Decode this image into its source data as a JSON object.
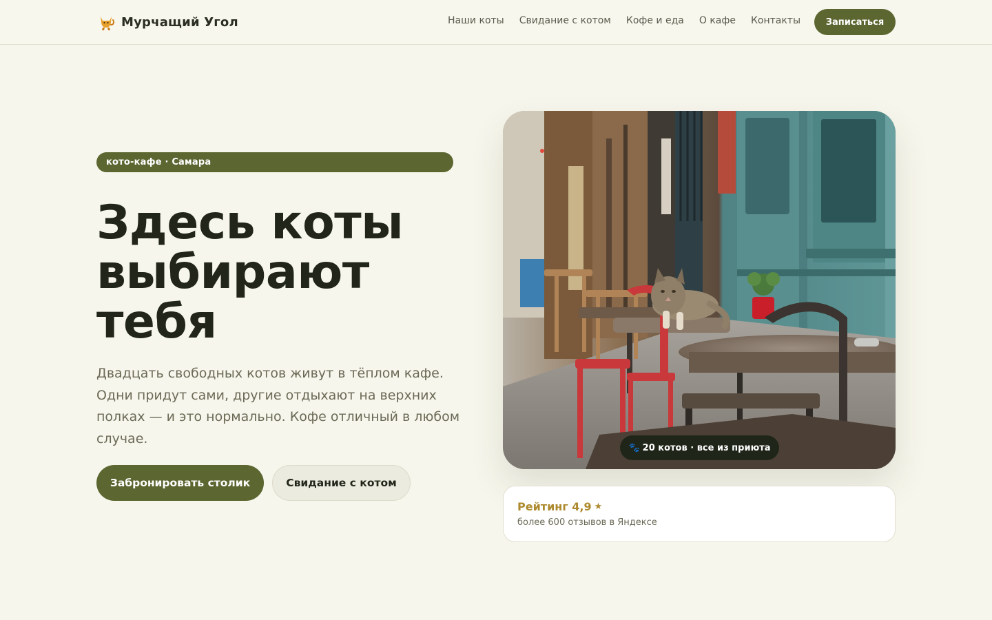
{
  "header": {
    "brand_name": "Мурчащий Угол",
    "brand_icon": "cat-icon",
    "nav": [
      "Наши коты",
      "Свидание с котом",
      "Кофе и еда",
      "О кафе",
      "Контакты"
    ],
    "cta_label": "Записаться"
  },
  "hero": {
    "tag": "кото-кафе · Самара",
    "title_lines": [
      "Здесь коты",
      "выбирают",
      "тебя"
    ],
    "lead": "Двадцать свободных котов живут в тёплом кафе. Одни придут сами, другие отдыхают на верхних полках — и это нормально. Кофе отличный в любом случае.",
    "primary_button": "Забронировать столик",
    "secondary_button": "Свидание с котом",
    "photo_badge": "20 котов · все из приюта",
    "photo_badge_icon": "paw-icon",
    "rating_title": "Рейтинг 4,9",
    "rating_icon": "star-icon",
    "rating_sub": "более 600 отзывов в Яндексе"
  },
  "colors": {
    "background": "#f7f6ec",
    "accent": "#5b6630",
    "rating": "#ad8a2e",
    "text": "#22261a"
  }
}
